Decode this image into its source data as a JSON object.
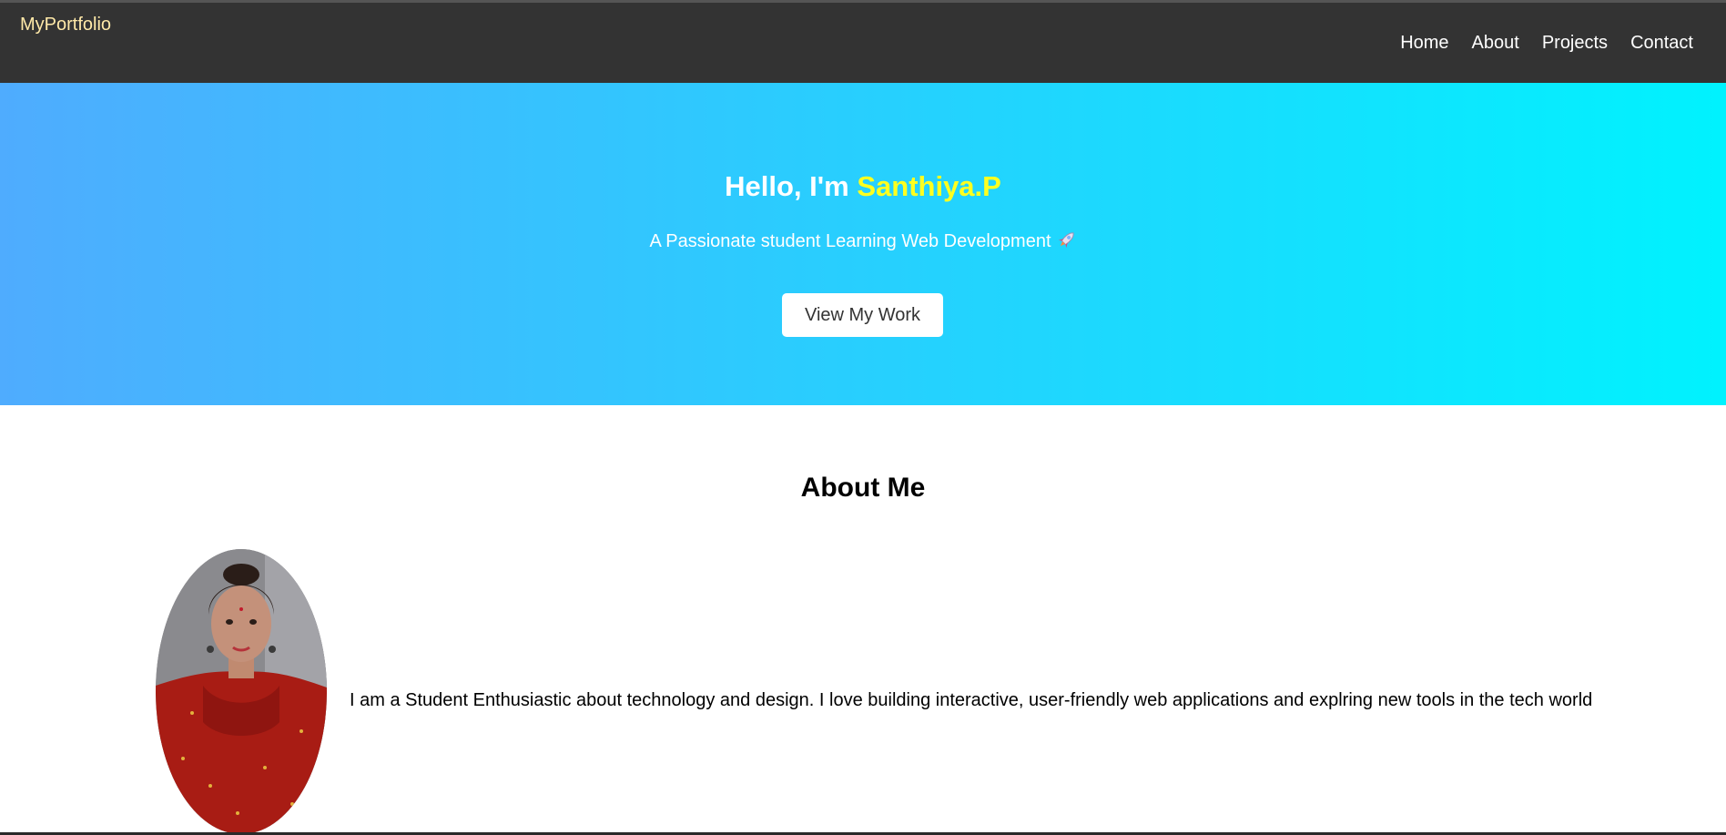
{
  "navbar": {
    "logo": "MyPortfolio",
    "links": [
      "Home",
      "About",
      "Projects",
      "Contact"
    ]
  },
  "hero": {
    "greeting": "Hello, I'm ",
    "name": "Santhiya.P",
    "subtitle": "A Passionate student Learning Web Development",
    "subtitle_icon": "rocket-icon",
    "button_label": "View My Work",
    "gradient_start": "#4facfe",
    "gradient_end": "#00f2fe",
    "name_color": "#ffff1f"
  },
  "about": {
    "title": "About Me",
    "text": "I am a Student Enthusiastic about technology and design. I love building interactive, user-friendly web applications and explring new tools in the tech world"
  },
  "colors": {
    "navbar_bg": "#333333",
    "logo": "#ffe9a8"
  }
}
